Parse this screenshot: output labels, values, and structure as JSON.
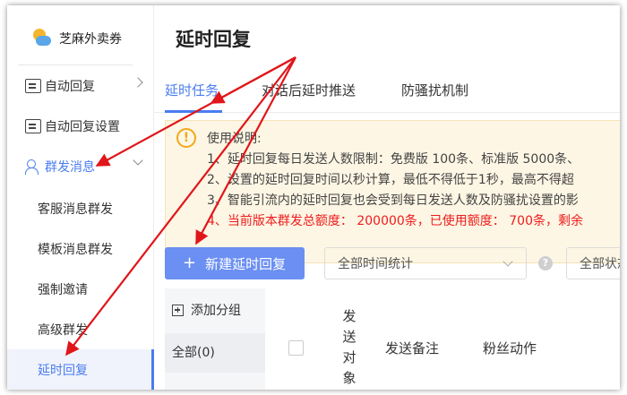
{
  "brand": {
    "name": "芝麻外卖券",
    "logo_icon": "sun-cloud-logo-icon"
  },
  "sidebar": {
    "items": [
      {
        "label": "自动回复",
        "icon": "chat-icon",
        "chevron": "right"
      },
      {
        "label": "自动回复设置",
        "icon": "chat-icon"
      },
      {
        "label": "群发消息",
        "icon": "users-icon",
        "chevron": "down",
        "expanded": true
      }
    ],
    "sub_items": [
      {
        "label": "客服消息群发"
      },
      {
        "label": "模板消息群发"
      },
      {
        "label": "强制邀请"
      },
      {
        "label": "高级群发"
      },
      {
        "label": "延时回复",
        "selected": true
      }
    ]
  },
  "main": {
    "title": "延时回复",
    "tabs": [
      {
        "label": "延时任务",
        "active": true
      },
      {
        "label": "对话后延时推送"
      },
      {
        "label": "防骚扰机制"
      }
    ],
    "notice": {
      "icon": "warning-icon",
      "lines": [
        "使用说明:",
        "1、延时回复每日发送人数限制：免费版 100条、标准版 5000条、",
        "2、设置的延时回复时间以秒计算，最低不得低于1秒，最高不得超",
        "3、智能引流内的延时回复也会受到每日发送人数及防骚扰设置的影",
        "4、当前版本群发总额度： 200000条，已使用额度： 700条，剩余"
      ]
    },
    "toolbar": {
      "new_button": "新建延时回复",
      "filter_select": "全部时间统计",
      "filter_select2": "全部状态",
      "help_icon": "question-icon"
    },
    "groups": {
      "add_label": "添加分组",
      "all_label": "全部(0)"
    },
    "table": {
      "columns": [
        "发送对象",
        "发送备注",
        "粉丝动作"
      ]
    }
  },
  "colors": {
    "accent": "#4a7cf0",
    "button": "#6b8ff2",
    "notice_bg": "#fdf6e4",
    "warning_text": "#ee1c1c",
    "annotation_arrow": "#e0161a"
  }
}
